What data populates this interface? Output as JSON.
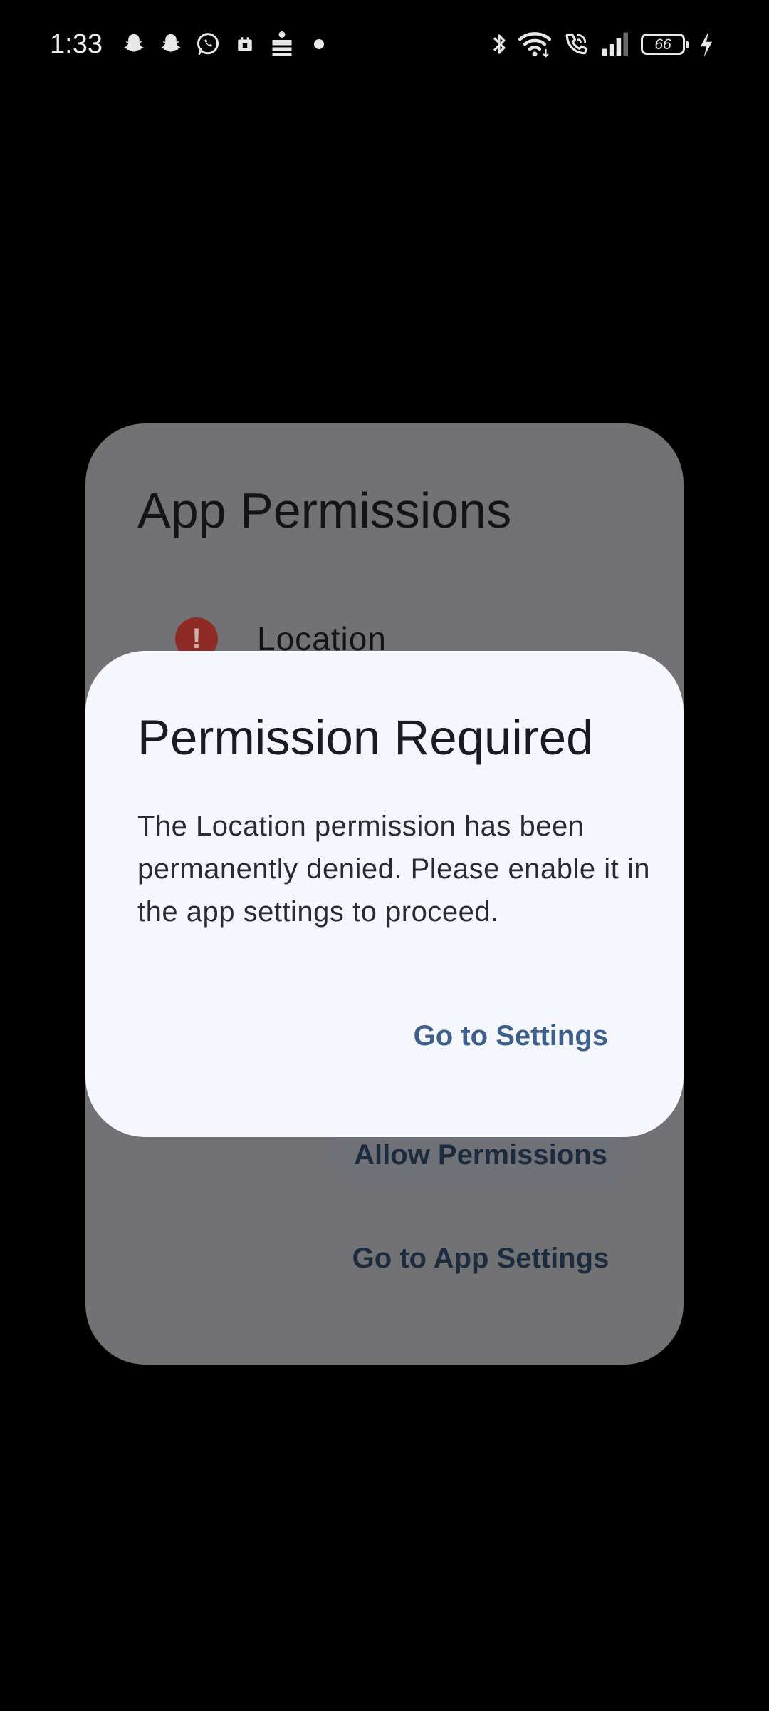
{
  "status_bar": {
    "time": "1:33",
    "notification_icons": [
      "snapchat-icon",
      "snapchat-icon",
      "whatsapp-icon",
      "calendar-icon",
      "news-app-icon",
      "dot-icon"
    ],
    "system_icons": [
      "bluetooth-icon",
      "wifi-icon",
      "wifi-calling-icon",
      "signal-icon",
      "battery-icon",
      "charging-icon"
    ],
    "battery_level": "66"
  },
  "background_dialog": {
    "title": "App Permissions",
    "permissions": [
      {
        "label": "Location",
        "status_icon": "error-icon",
        "status_symbol": "!"
      }
    ],
    "allow_button": "Allow Permissions",
    "app_settings_button": "Go to App Settings"
  },
  "permission_dialog": {
    "title": "Permission Required",
    "message": "The Location permission has been permanently denied. Please enable it in the app settings to proceed.",
    "action_label": "Go to Settings"
  },
  "colors": {
    "screen_background": "#000000",
    "scrim_dialog": "#727275",
    "dialog_surface": "#f6f7fc",
    "primary_action": "#3d5f8c",
    "error": "#8d2a24"
  }
}
